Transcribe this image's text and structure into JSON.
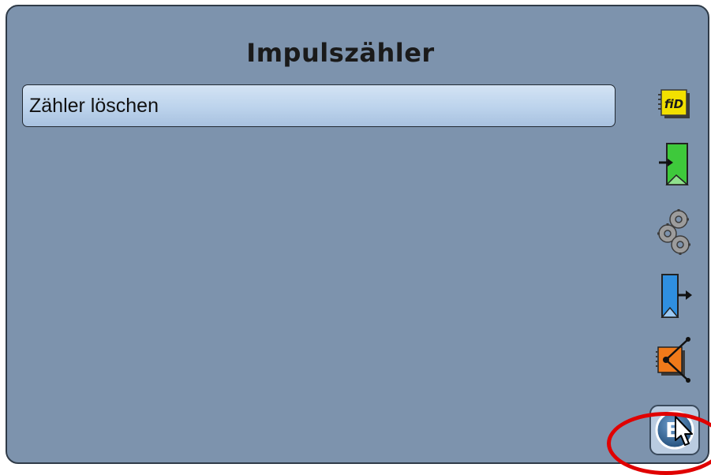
{
  "page": {
    "title": "Impulszähler"
  },
  "menu": {
    "items": [
      {
        "label": "Zähler löschen"
      }
    ]
  },
  "sidebar": {
    "icons": [
      {
        "name": "fid-icon",
        "label": "fiD",
        "color": "#f2e000"
      },
      {
        "name": "input-icon",
        "color": "#3ec93b"
      },
      {
        "name": "gears-icon",
        "color": "#9a9a9a"
      },
      {
        "name": "output-icon",
        "color": "#2f8fe0"
      },
      {
        "name": "function-icon",
        "color": "#f07a1a"
      },
      {
        "name": "exit-icon",
        "label": "E",
        "color": "#2b5f8f"
      }
    ]
  },
  "colors": {
    "background": "#7d93ad",
    "highlight": "#e00000"
  }
}
